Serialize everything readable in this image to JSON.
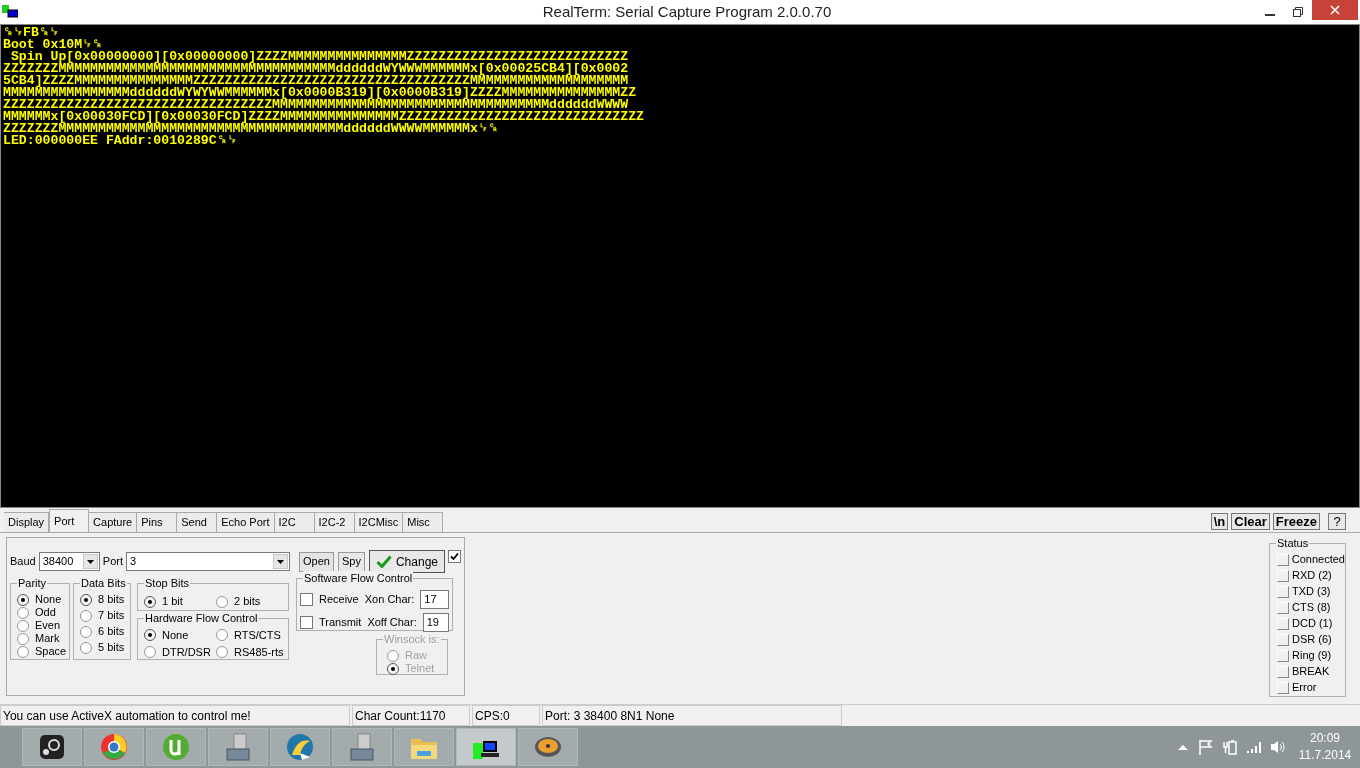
{
  "window": {
    "title": "RealTerm: Serial Capture Program 2.0.0.70"
  },
  "terminal": {
    "lines": [
      "␍␊FB␍␊",
      "Boot 0x10M␊␍",
      " Spin Up[0x00000000][0x00000000]ZZZZMMMMMMMMMMMMMMMZZZZZZZZZZZZZZZZZZZZZZZZZZZZ",
      "ZZZZZZZMMMMMMMMMMMMMMMMMMMMMMMMMMMMMMMMMMMddddddWYWWWMMMMMMx[0x00025CB4][0x0002",
      "5CB4]ZZZZMMMMMMMMMMMMMMMZZZZZZZZZZZZZZZZZZZZZZZZZZZZZZZZZZZMMMMMMMMMMMMMMMMMMMM",
      "MMMMMMMMMMMMMMMMddddddWYWYWWMMMMMMx[0x0000B319][0x0000B319]ZZZZMMMMMMMMMMMMMMMZZ",
      "ZZZZZZZZZZZZZZZZZZZZZZZZZZZZZZZZZZMMMMMMMMMMMMMMMMMMMMMMMMMMMMMMMMMMMddddddWWWW",
      "MMMMMMx[0x00030FCD][0x00030FCD]ZZZZMMMMMMMMMMMMMMMZZZZZZZZZZZZZZZZZZZZZZZZZZZZZZZ",
      "ZZZZZZZMMMMMMMMMMMMMMMMMMMMMMMMMMMMMMMMMMMMddddddWWWWMMMMMMx␊␍",
      "LED:000000EE FAddr:0010289C␍␊"
    ]
  },
  "tabs": [
    {
      "label": "Display",
      "selected": false
    },
    {
      "label": "Port",
      "selected": true
    },
    {
      "label": "Capture",
      "selected": false
    },
    {
      "label": "Pins",
      "selected": false
    },
    {
      "label": "Send",
      "selected": false
    },
    {
      "label": "Echo Port",
      "selected": false
    },
    {
      "label": "I2C",
      "selected": false
    },
    {
      "label": "I2C-2",
      "selected": false
    },
    {
      "label": "I2CMisc",
      "selected": false
    },
    {
      "label": "Misc",
      "selected": false
    }
  ],
  "toolbar_buttons": [
    "\\n",
    "Clear",
    "Freeze",
    "?"
  ],
  "baud": {
    "label": "Baud",
    "value": "38400"
  },
  "port": {
    "label": "Port",
    "value": "3"
  },
  "buttons": {
    "open": "Open",
    "spy": "Spy",
    "change": "Change"
  },
  "change_checkbox": {
    "checked": true
  },
  "parity": {
    "title": "Parity",
    "options": [
      {
        "label": "None",
        "selected": true
      },
      {
        "label": "Odd",
        "selected": false
      },
      {
        "label": "Even",
        "selected": false
      },
      {
        "label": "Mark",
        "selected": false
      },
      {
        "label": "Space",
        "selected": false
      }
    ]
  },
  "data_bits": {
    "title": "Data Bits",
    "options": [
      {
        "label": "8 bits",
        "selected": true
      },
      {
        "label": "7 bits",
        "selected": false
      },
      {
        "label": "6 bits",
        "selected": false
      },
      {
        "label": "5 bits",
        "selected": false
      }
    ]
  },
  "stop_bits": {
    "title": "Stop Bits",
    "options": [
      {
        "label": "1 bit",
        "selected": true
      },
      {
        "label": "2 bits",
        "selected": false
      }
    ]
  },
  "hardware_flow": {
    "title": "Hardware Flow Control",
    "options": [
      {
        "label": "None",
        "selected": true
      },
      {
        "label": "RTS/CTS",
        "selected": false
      },
      {
        "label": "DTR/DSR",
        "selected": false
      },
      {
        "label": "RS485-rts",
        "selected": false
      }
    ]
  },
  "software_flow": {
    "title": "Software Flow Control",
    "rows": [
      {
        "label": "Receive",
        "checked": false,
        "char_label": "Xon Char:",
        "char_value": "17"
      },
      {
        "label": "Transmit",
        "checked": false,
        "char_label": "Xoff Char:",
        "char_value": "19"
      }
    ]
  },
  "winsock": {
    "title": "Winsock is:",
    "disabled": true,
    "options": [
      {
        "label": "Raw",
        "selected": false
      },
      {
        "label": "Telnet",
        "selected": true
      }
    ]
  },
  "status": {
    "title": "Status",
    "items": [
      {
        "label": "Connected",
        "on": false
      },
      {
        "label": "RXD (2)",
        "on": false
      },
      {
        "label": "TXD (3)",
        "on": false
      },
      {
        "label": "CTS (8)",
        "on": false
      },
      {
        "label": "DCD (1)",
        "on": false
      },
      {
        "label": "DSR (6)",
        "on": false
      },
      {
        "label": "Ring (9)",
        "on": false
      },
      {
        "label": "BREAK",
        "on": false
      },
      {
        "label": "Error",
        "on": false
      }
    ]
  },
  "status_bar": [
    "You can use ActiveX automation to control me!",
    "Char Count:1170",
    "CPS:0",
    "Port: 3 38400 8N1 None"
  ],
  "taskbar": {
    "time": "20:09",
    "date": "11.7.2014"
  }
}
